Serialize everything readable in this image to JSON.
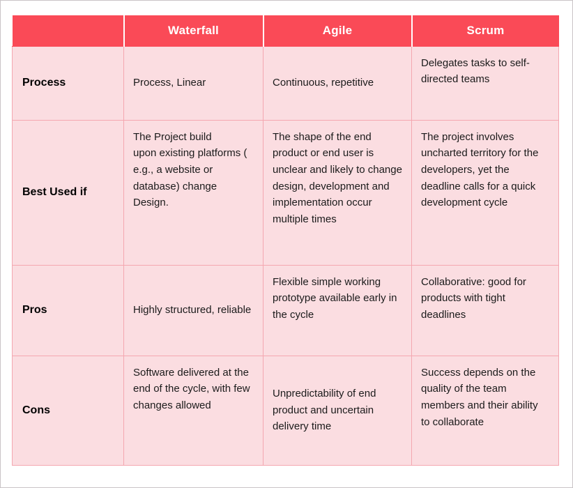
{
  "table": {
    "headers": [
      {
        "label": "",
        "name": "corner"
      },
      {
        "label": "Waterfall",
        "name": "waterfall"
      },
      {
        "label": "Agile",
        "name": "agile"
      },
      {
        "label": "Scrum",
        "name": "scrum"
      }
    ],
    "rows": [
      {
        "label": "Process",
        "waterfall": "Process, Linear",
        "agile": "Continuous, repetitive",
        "scrum": "Delegates tasks to self-directed teams"
      },
      {
        "label": "Best Used if",
        "waterfall": "The Project build\n upon existing platforms ( e.g., a website or database) change Design.",
        "agile": "The shape of the end product or end user is unclear and likely to change design, development and implementation occur multiple times",
        "scrum": "The project involves uncharted territory for the developers, yet the deadline calls for a quick development cycle"
      },
      {
        "label": "Pros",
        "waterfall": "Highly structured, reliable",
        "agile": "Flexible simple working prototype available early in the cycle",
        "scrum": "Collaborative: good for products with tight deadlines"
      },
      {
        "label": "Cons",
        "waterfall": "Software delivered at the end of the cycle, with few changes allowed",
        "agile": "Unpredictability of end product and uncertain delivery time",
        "scrum": "Success depends on the quality of the team members and their ability to collaborate"
      }
    ]
  },
  "colors": {
    "header_background": "#fa4a57",
    "header_text": "#ffffff",
    "cell_background": "#fbdde1",
    "cell_border": "#f4a7b0",
    "cell_text": "#1b1b1b",
    "page_background": "#ffffff",
    "page_border": "#c9c4c6"
  }
}
